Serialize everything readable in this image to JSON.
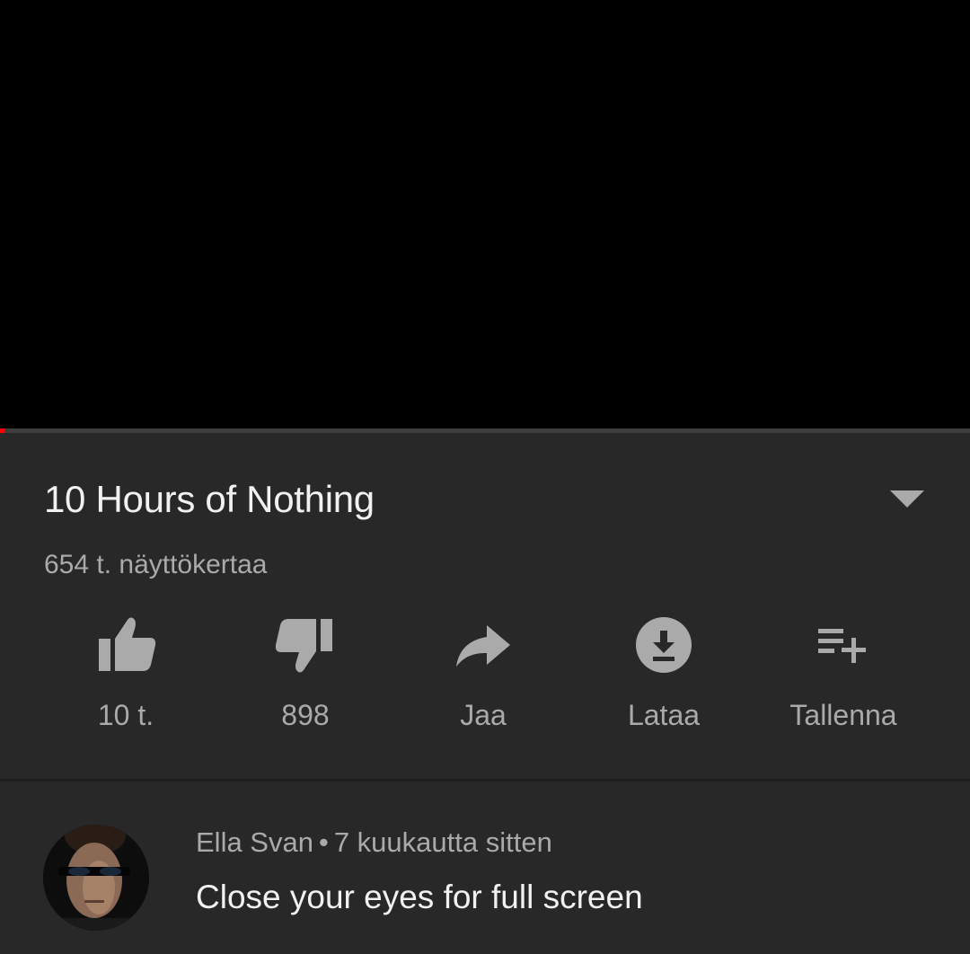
{
  "video": {
    "title": "10 Hours of Nothing",
    "views": "654 t. näyttökertaa",
    "progress": 0.005
  },
  "actions": [
    {
      "icon": "thumbs-up-icon",
      "label": "10 t."
    },
    {
      "icon": "thumbs-down-icon",
      "label": "898"
    },
    {
      "icon": "share-icon",
      "label": "Jaa"
    },
    {
      "icon": "download-icon",
      "label": "Lataa"
    },
    {
      "icon": "save-to-playlist-icon",
      "label": "Tallenna"
    }
  ],
  "comment": {
    "author": "Ella Svan",
    "separator": "•",
    "time": "7 kuukautta sitten",
    "text": "Close your eyes for full screen"
  },
  "colors": {
    "background": "#282828",
    "player": "#000000",
    "accent": "#ff0000",
    "text_primary": "#f1f1f1",
    "text_secondary": "#aaaaaa"
  }
}
